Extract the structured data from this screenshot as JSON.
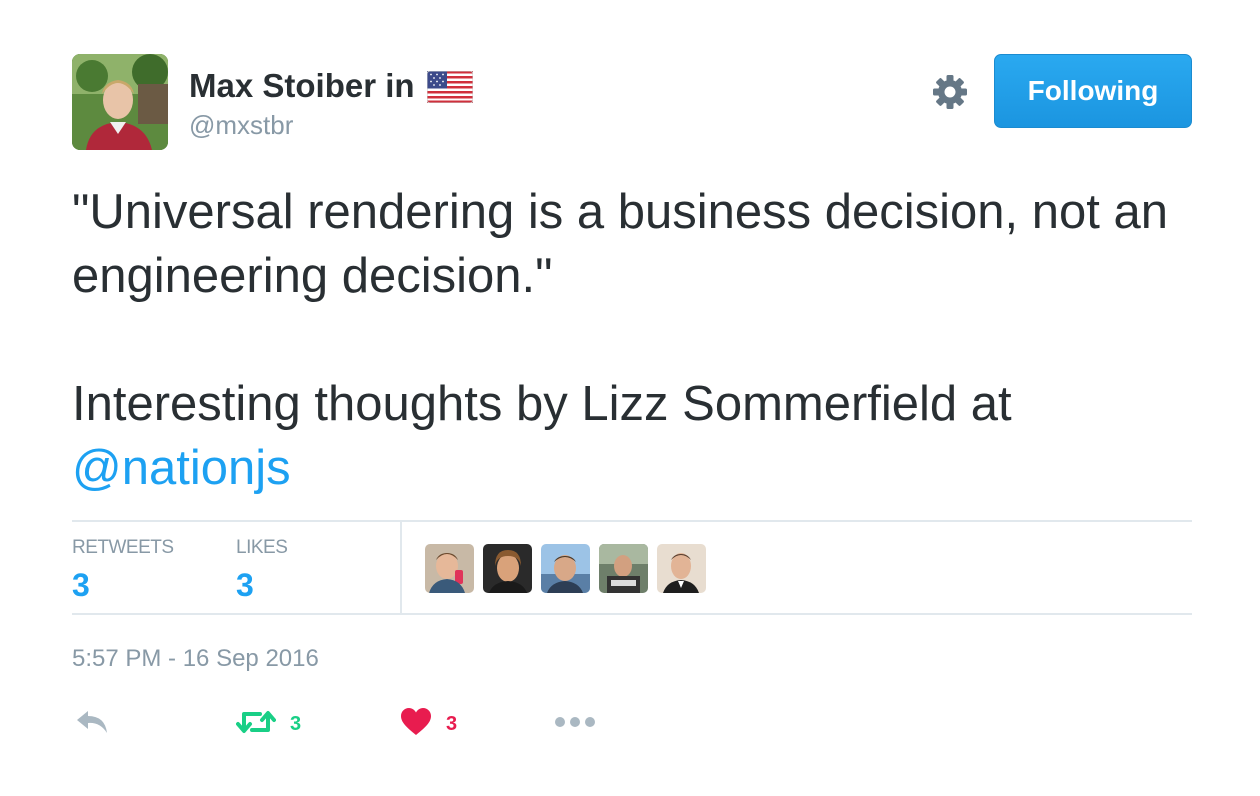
{
  "user": {
    "display_name": "Max Stoiber in",
    "handle": "@mxstbr",
    "flag_icon": "us-flag-icon",
    "avatar_icon": "profile-photo"
  },
  "header": {
    "settings_icon": "gear-icon",
    "follow_button_label": "Following",
    "follow_button_color": "#1da1f2"
  },
  "tweet": {
    "line1": "\"Universal rendering is a business decision, not an engineering decision.\"",
    "line2_text": "Interesting thoughts by Lizz Sommerfield at ",
    "mention": "@nationjs"
  },
  "stats": {
    "retweets_label": "RETWEETS",
    "retweets_count": "3",
    "likes_label": "LIKES",
    "likes_count": "3",
    "likers": [
      "liker-avatar-1",
      "liker-avatar-2",
      "liker-avatar-3",
      "liker-avatar-4",
      "liker-avatar-5"
    ]
  },
  "timestamp": "5:57 PM - 16 Sep 2016",
  "actions": {
    "reply_icon": "reply-icon",
    "retweet_icon": "retweet-icon",
    "retweet_count": "3",
    "retweet_color": "#19cf86",
    "like_icon": "heart-icon",
    "like_count": "3",
    "like_color": "#e81c4f",
    "more_icon": "more-dots-icon"
  }
}
